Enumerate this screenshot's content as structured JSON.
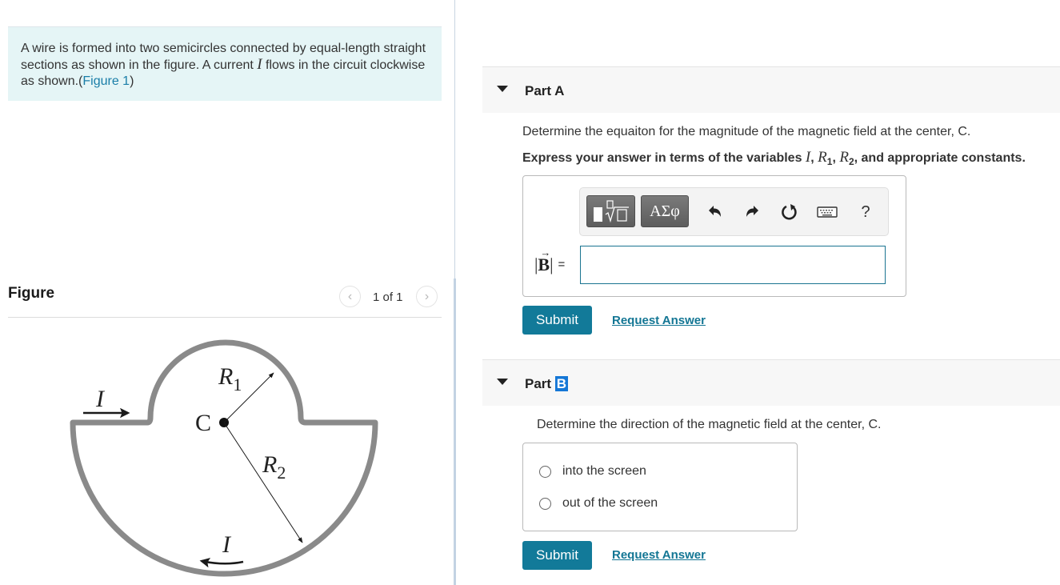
{
  "problem": {
    "text_before_var": "A wire is formed into two semicircles connected by equal-length straight sections as shown in the figure. A current ",
    "variable": "I",
    "text_after_var": " flows in the circuit clockwise as shown.",
    "figure_link_open": "(",
    "figure_link": "Figure 1",
    "figure_link_close": ")"
  },
  "figure_panel": {
    "title": "Figure",
    "pager": {
      "current": 1,
      "total": 1,
      "text": "1 of 1",
      "prev_icon": "chevron-left",
      "next_icon": "chevron-right"
    },
    "labels": {
      "current_top": "I",
      "current_bottom": "I",
      "center": "C",
      "r1": "R",
      "r1_sub": "1",
      "r2": "R",
      "r2_sub": "2"
    },
    "colors": {
      "wire": "#8a8a8a",
      "arrow": "#1a1a1a"
    }
  },
  "parts": [
    {
      "label_prefix": "Part ",
      "label_letter": "A",
      "question": "Determine the equaiton for the magnitude of the magnetic field at the center, C.",
      "instruction_prefix": "Express your answer in terms of the variables ",
      "instruction_vars": [
        "I",
        "R",
        "1",
        "R",
        "2"
      ],
      "instruction_suffix": ", and appropriate constants.",
      "toolbar": {
        "templates_icon": "templates-sqrt-icon",
        "greek_label": "ΑΣφ",
        "undo_icon": "undo-icon",
        "redo_icon": "redo-icon",
        "reset_icon": "reset-icon",
        "keyboard_icon": "keyboard-icon",
        "help_label": "?"
      },
      "answer_label": "B",
      "answer_equals": "=",
      "answer_value": "",
      "submit_label": "Submit",
      "request_label": "Request Answer"
    },
    {
      "label_prefix": "Part ",
      "label_letter": "B",
      "question": "Determine the direction of the magnetic field at the center, C.",
      "options": [
        "into the screen",
        "out of the screen"
      ],
      "selected": null,
      "submit_label": "Submit",
      "request_label": "Request Answer"
    }
  ],
  "colors": {
    "accent": "#127a99",
    "link": "#137694",
    "intro_bg": "#e5f5f6",
    "highlight": "#1577d6"
  }
}
